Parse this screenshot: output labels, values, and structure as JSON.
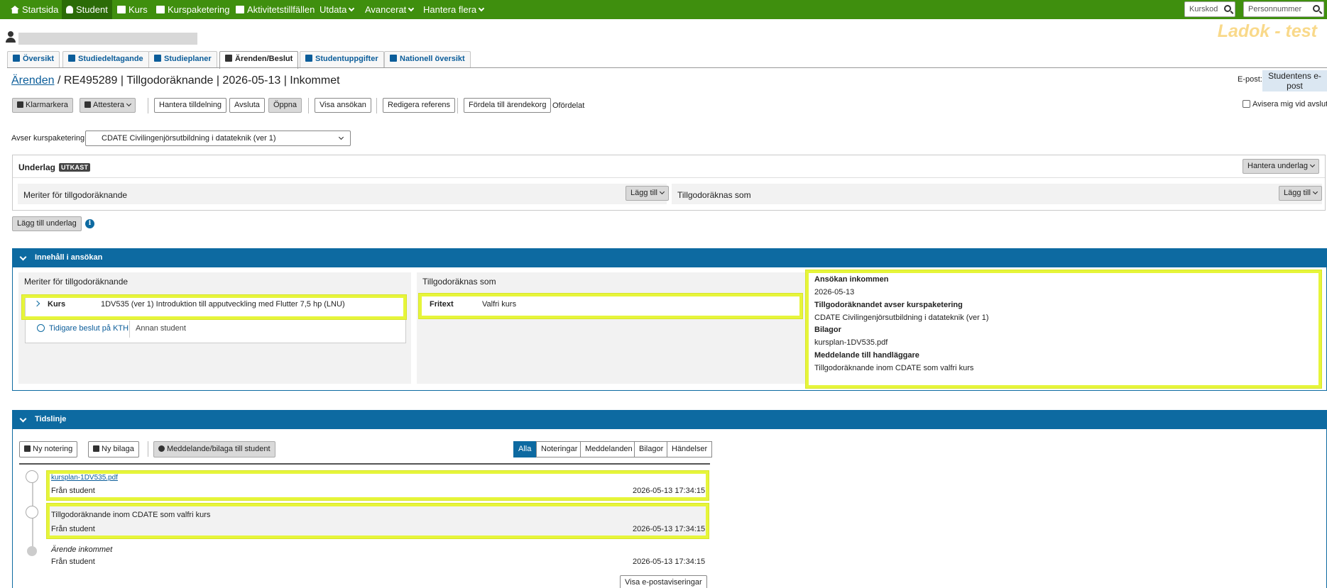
{
  "nav": {
    "items": [
      {
        "label": "Startsida",
        "icon": "home-icon"
      },
      {
        "label": "Student",
        "icon": "person-icon"
      },
      {
        "label": "Kurs",
        "icon": "book-icon"
      },
      {
        "label": "Kurspaketering",
        "icon": "folder-icon"
      },
      {
        "label": "Aktivitetstillfällen",
        "icon": "calendar-icon"
      },
      {
        "label": "Utdata"
      },
      {
        "label": "Avancerat"
      },
      {
        "label": "Hantera flera"
      }
    ],
    "kurskod_placeholder": "Kurskod",
    "personnummer_placeholder": "Personnummer"
  },
  "brand": "Ladok - test",
  "tabs": [
    "Översikt",
    "Studiedeltagande",
    "Studieplaner",
    "Ärenden/Beslut",
    "Studentuppgifter",
    "Nationell översikt"
  ],
  "breadcrumb": {
    "link": "Ärenden",
    "rest": " / RE495289 | Tillgodoräknande | 2026-05-13 | Inkommet"
  },
  "email": {
    "label": "E-post:",
    "value": "Studentens e-post"
  },
  "actions": {
    "klarmarkera": "Klarmarkera",
    "attestera": "Attestera",
    "hantera_tilldelning": "Hantera tilldelning",
    "avsluta": "Avsluta",
    "oppna": "Öppna",
    "visa_ansokan": "Visa ansökan",
    "redigera_referens": "Redigera referens",
    "fordela": "Fördela till ärendekorg",
    "ofordelat": "Ofördelat",
    "avisera": "Avisera mig vid avslut"
  },
  "kurspaketering": {
    "label": "Avser kurspaketering",
    "value": "CDATE Civilingenjörsutbildning i datateknik (ver 1)"
  },
  "underlag": {
    "title": "Underlag",
    "badge": "UTKAST",
    "hantera": "Hantera underlag",
    "meriter": "Meriter för tillgodoräknande",
    "tillgodo": "Tillgodoräknas som",
    "lagg_till": "Lägg till",
    "lagg_till_underlag": "Lägg till underlag"
  },
  "innehall": {
    "title": "Innehåll i ansökan",
    "meriter_title": "Meriter för tillgodoräknande",
    "kurs_label": "Kurs",
    "kurs_value": "1DV535 (ver 1) Introduktion till apputveckling med Flutter 7,5 hp (LNU)",
    "tidigare": "Tidigare beslut på KTH",
    "annan": "Annan student",
    "tillgodo_title": "Tillgodoräknas som",
    "fritext_label": "Fritext",
    "fritext_value": "Valfri kurs",
    "details": [
      {
        "label": "Ansökan inkommen",
        "value": "2026-05-13"
      },
      {
        "label": "Tillgodoräknandet avser kurspaketering",
        "value": "CDATE Civilingenjörsutbildning i datateknik (ver 1)"
      },
      {
        "label": "Bilagor",
        "value": "kursplan-1DV535.pdf"
      },
      {
        "label": "Meddelande till handläggare",
        "value": "Tillgodoräknande inom CDATE som valfri kurs"
      }
    ]
  },
  "tidslinje": {
    "title": "Tidslinje",
    "ny_notering": "Ny notering",
    "ny_bilaga": "Ny bilaga",
    "meddelande": "Meddelande/bilaga till student",
    "filters": [
      "Alla",
      "Noteringar",
      "Meddelanden",
      "Bilagor",
      "Händelser"
    ],
    "entries": [
      {
        "title": "kursplan-1DV535.pdf",
        "from": "Från student",
        "time": "2026-05-13 17:34:15"
      },
      {
        "title": "Tillgodoräknande inom CDATE som valfri kurs",
        "from": "Från student",
        "time": "2026-05-13 17:34:15"
      },
      {
        "title": "Ärende inkommet",
        "from": "Från student",
        "time": "2026-05-13 17:34:15"
      }
    ],
    "visa_epost": "Visa e-postaviseringar"
  }
}
